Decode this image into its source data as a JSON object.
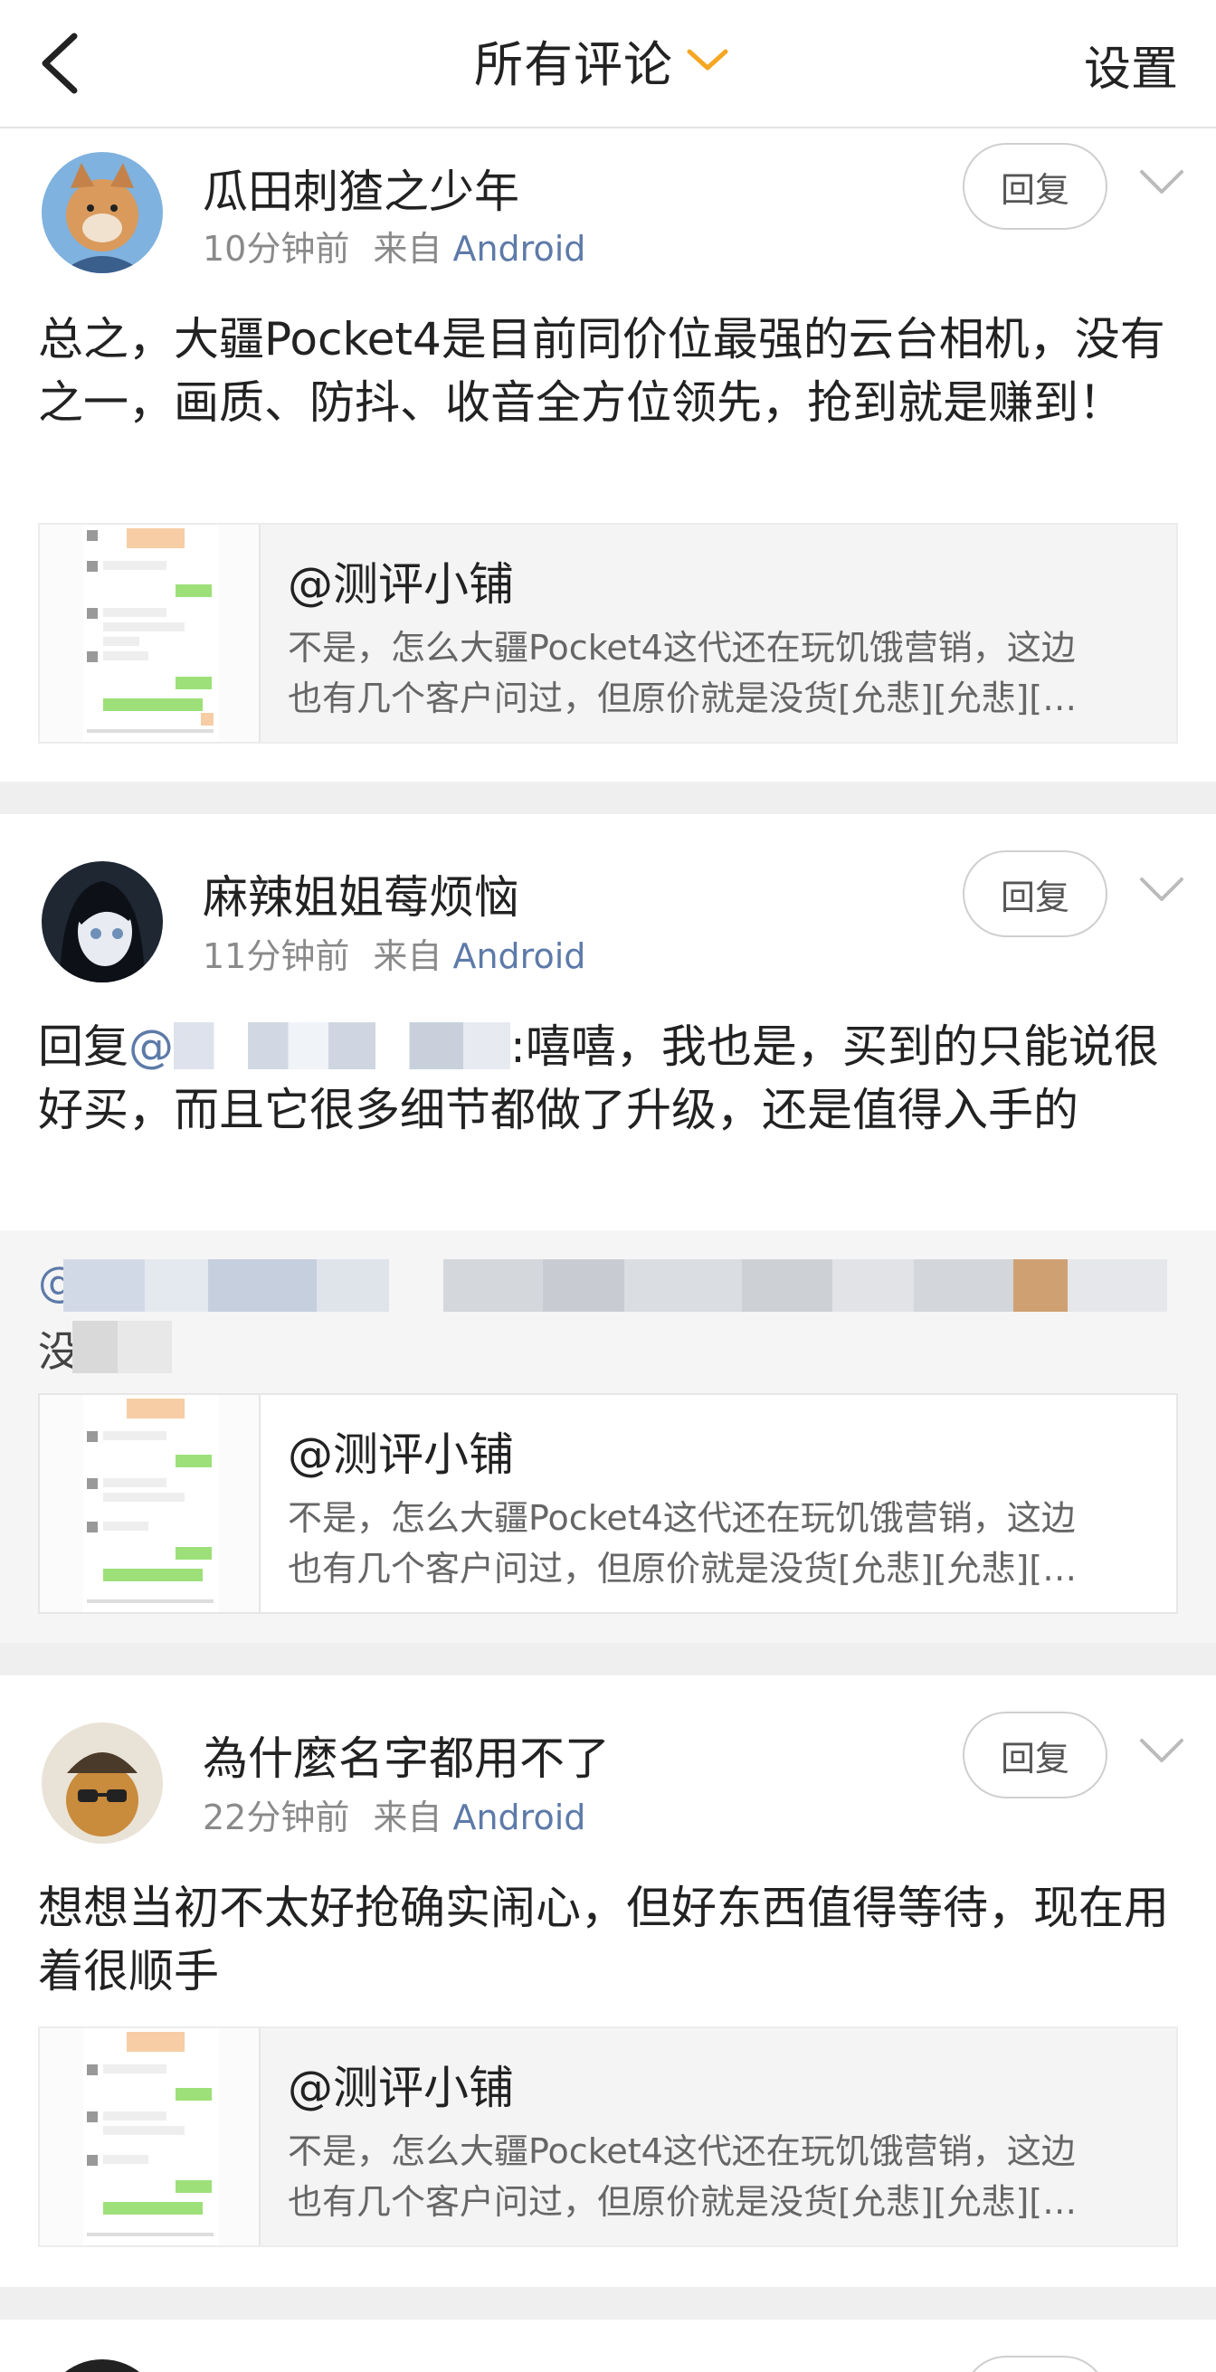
{
  "nav": {
    "title": "所有评论",
    "settings": "设置",
    "back_icon": "chevron-left-icon",
    "title_dropdown_icon": "chevron-down-icon",
    "accent": "#F5A623"
  },
  "comments": [
    {
      "username": "瓜田刺猹之少年",
      "time": "10分钟前",
      "source_prefix": "来自",
      "source": "Android",
      "reply_label": "回复",
      "text": "总之，大疆Pocket4是目前同价位最强的云台相机，没有之一，画质、防抖、收音全方位领先，抢到就是赚到！",
      "quote": {
        "title": "@测评小铺",
        "line1": "不是，怎么大疆Pocket4这代还在玩饥饿营销，这边",
        "line2": "也有几个客户问过，但原价就是没货[允悲][允悲][…"
      }
    },
    {
      "username": "麻辣姐姐莓烦恼",
      "time": "11分钟前",
      "source_prefix": "来自",
      "source": "Android",
      "reply_label": "回复",
      "text_prefix": "回复",
      "mention": "@",
      "text_after": ":嘻嘻，我也是，买到的只能说很好买，而且它很多细节都做了升级，还是值得入手的",
      "quote": {
        "title": "@测评小铺",
        "line1": "不是，怎么大疆Pocket4这代还在玩饥饿营销，这边",
        "line2": "也有几个客户问过，但原价就是没货[允悲][允悲][…"
      }
    },
    {
      "username": "為什麼名字都用不了",
      "time": "22分钟前",
      "source_prefix": "来自",
      "source": "Android",
      "reply_label": "回复",
      "text": "想想当初不太好抢确实闹心，但好东西值得等待，现在用着很顺手",
      "quote": {
        "title": "@测评小铺",
        "line1": "不是，怎么大疆Pocket4这代还在玩饥饿营销，这边",
        "line2": "也有几个客户问过，但原价就是没货[允悲][允悲][…"
      }
    }
  ],
  "reply_quote_visible": {
    "start_char": "@",
    "second_line_char": "没"
  }
}
